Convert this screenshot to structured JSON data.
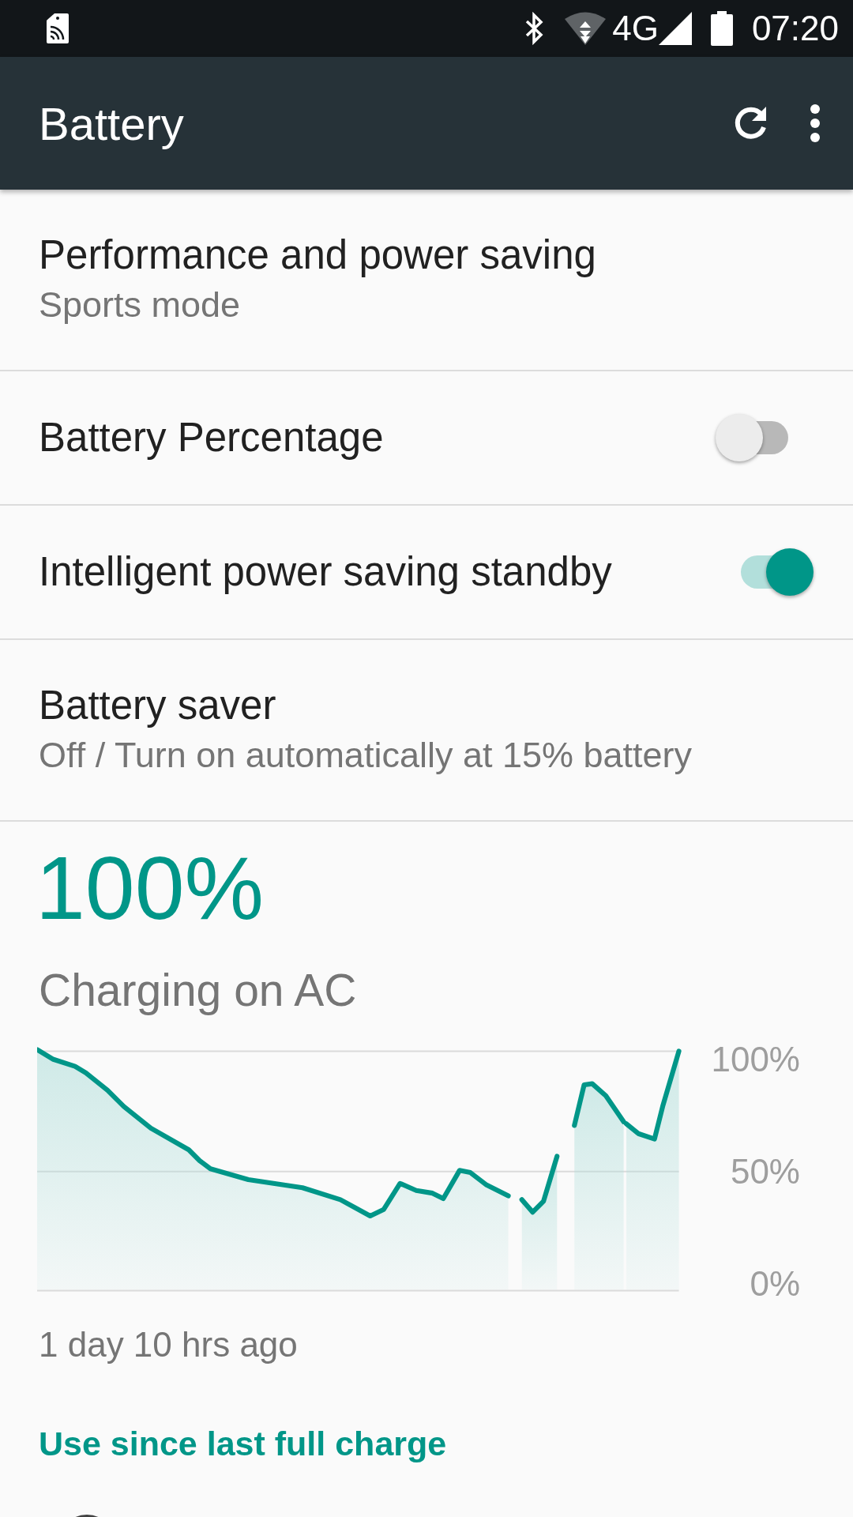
{
  "status_bar": {
    "network": "4G",
    "time": "07:20"
  },
  "app_bar": {
    "title": "Battery"
  },
  "settings": [
    {
      "kind": "text",
      "title": "Performance and power saving",
      "summary": "Sports mode"
    },
    {
      "kind": "switch",
      "title": "Battery Percentage",
      "on": false
    },
    {
      "kind": "switch",
      "title": "Intelligent power saving standby",
      "on": true
    },
    {
      "kind": "text",
      "title": "Battery saver",
      "summary": "Off / Turn on automatically at 15% battery"
    }
  ],
  "battery": {
    "level_text": "100%",
    "status": "Charging on AC",
    "graph_labels": [
      "100%",
      "50%",
      "0%"
    ],
    "since": "1 day 10 hrs ago"
  },
  "section_header": "Use since last full charge"
}
